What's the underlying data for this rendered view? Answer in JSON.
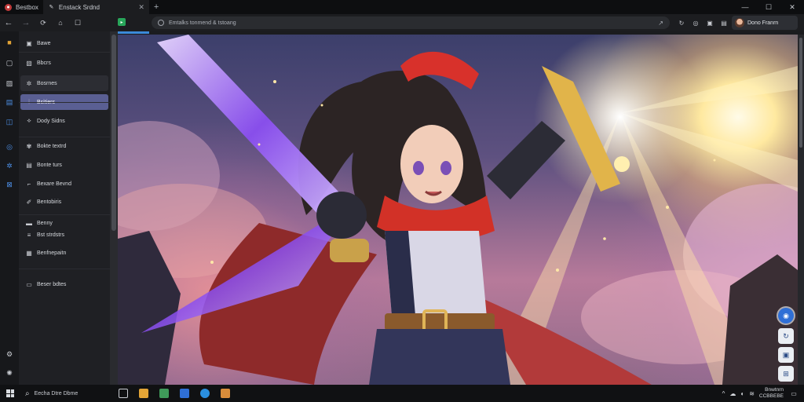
{
  "tabs": [
    {
      "label": "Bestbox",
      "icon": "red-circle-icon",
      "active": false
    },
    {
      "label": "Enstack Srdnd",
      "icon": "brush-icon",
      "active": true
    }
  ],
  "window_controls": {
    "minimize": "—",
    "maximize": "☐",
    "close": "✕"
  },
  "address_bar": {
    "url": "Emtalks tonmend & tstoang"
  },
  "profile": {
    "name": "Dono Franrn"
  },
  "sidebar": {
    "items": [
      {
        "label": "Bawe",
        "icon": "folder-icon",
        "state": ""
      },
      {
        "label": "Bbcrs",
        "icon": "image-icon",
        "state": ""
      },
      {
        "label": "Bosrnes",
        "icon": "gallery-icon",
        "state": "hl"
      },
      {
        "label": "Bsitiers",
        "icon": "layers-icon",
        "state": "active"
      },
      {
        "label": "Dody Sidns",
        "icon": "palette-icon",
        "state": ""
      },
      {
        "label": "Bokte textrd",
        "icon": "globe-icon",
        "state": ""
      },
      {
        "label": "Bonte turs",
        "icon": "grid-icon",
        "state": ""
      },
      {
        "label": "Bexare Bevnd",
        "icon": "frame-icon",
        "state": ""
      },
      {
        "label": "Bentobiris",
        "icon": "pen-icon",
        "state": ""
      },
      {
        "label": "Benny",
        "icon": "note-icon",
        "state": ""
      },
      {
        "label": "Bst strdstrs",
        "icon": "list-icon",
        "state": ""
      },
      {
        "label": "Benfnepaitn",
        "icon": "doc-icon",
        "state": ""
      },
      {
        "label": "Beser bdtes",
        "icon": "book-icon",
        "state": ""
      }
    ]
  },
  "taskbar": {
    "search_label": "Eecha Dtre Dbme",
    "clock_time": "Bnwtnrn",
    "clock_date": "CCBBEBE"
  },
  "colors": {
    "accent_active": "#5a5f93",
    "browser_bg": "#1c1d20",
    "loading_bar": "#3b8ad9"
  },
  "artwork": {
    "subject": "anime warrior girl with glowing purple sword"
  }
}
